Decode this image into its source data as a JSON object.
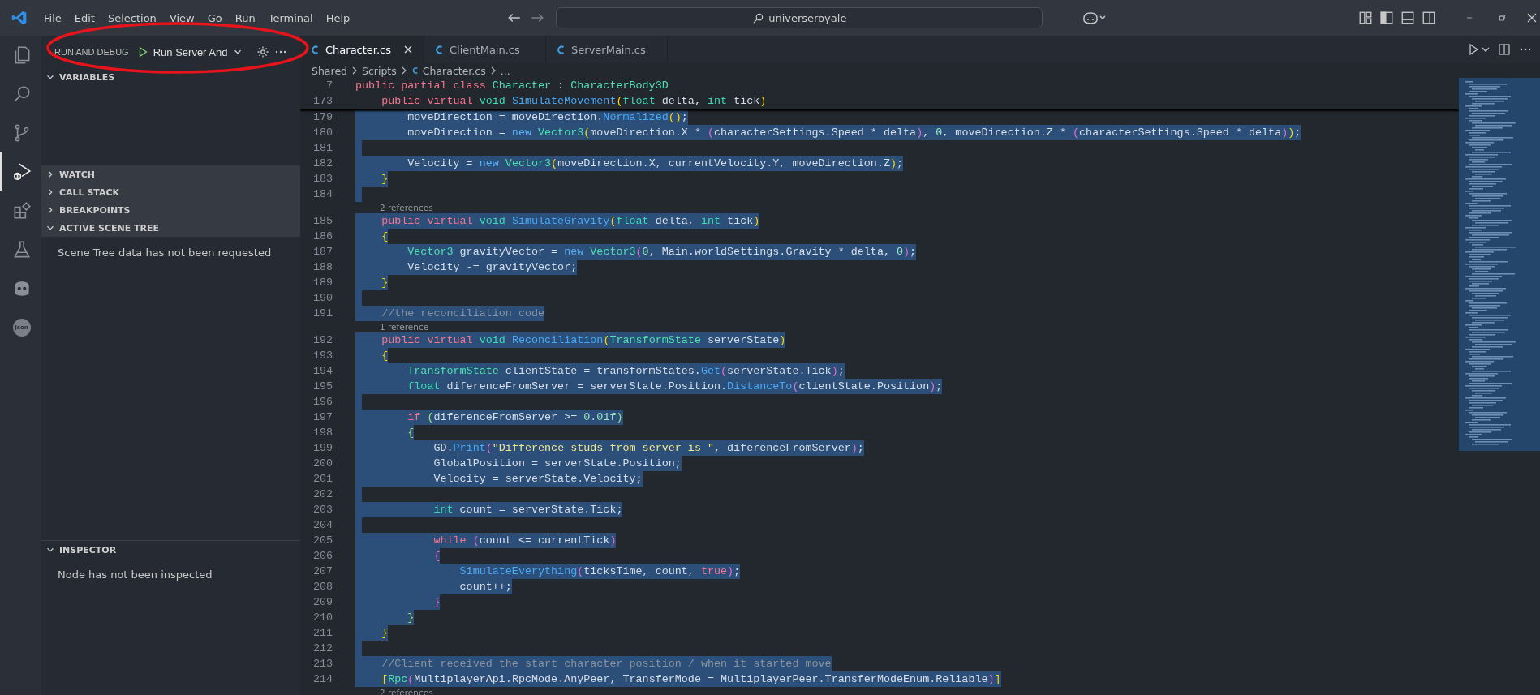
{
  "title_bar": {
    "menu": [
      "File",
      "Edit",
      "Selection",
      "View",
      "Go",
      "Run",
      "Terminal",
      "Help"
    ],
    "search": "universeroyale"
  },
  "activity_bar": [
    {
      "kind": "files",
      "selected": false
    },
    {
      "kind": "search",
      "selected": false
    },
    {
      "kind": "branch",
      "selected": false
    },
    {
      "kind": "debug",
      "selected": true
    },
    {
      "kind": "blocks",
      "selected": false
    },
    {
      "kind": "flask",
      "selected": false
    },
    {
      "kind": "robot",
      "selected": false
    },
    {
      "kind": "badge",
      "label": "Json",
      "selected": false
    }
  ],
  "sidebar": {
    "title": "RUN AND DEBUG",
    "configuration": "Run Server And",
    "sections": [
      {
        "title": "VARIABLES",
        "expanded": true
      },
      {
        "title": "WATCH",
        "expanded": false
      },
      {
        "title": "CALL STACK",
        "expanded": false
      },
      {
        "title": "BREAKPOINTS",
        "expanded": false
      },
      {
        "title": "ACTIVE SCENE TREE",
        "expanded": true,
        "message": "Scene Tree data has not been requested"
      },
      {
        "title": "INSPECTOR",
        "expanded": true,
        "message": "Node has not been inspected"
      }
    ]
  },
  "tabs": [
    {
      "label": "Character.cs",
      "selected": true
    },
    {
      "label": "ClientMain.cs",
      "selected": false
    },
    {
      "label": "ServerMain.cs",
      "selected": false
    }
  ],
  "breadcrumb": [
    "Shared",
    "Scripts",
    "Character.cs",
    "..."
  ],
  "sticky_scroll": [
    {
      "number": "7",
      "tokens": [
        {
          "text": "public partial class ",
          "kind": "kw"
        },
        {
          "text": "Character",
          "kind": "type"
        },
        {
          "text": " : ",
          "kind": "txt"
        },
        {
          "text": "CharacterBody3D",
          "kind": "type"
        }
      ]
    },
    {
      "number": "173",
      "tokens": [
        {
          "text": "    public virtual ",
          "kind": "kw"
        },
        {
          "text": "void ",
          "kind": "decl"
        },
        {
          "text": "SimulateMovement",
          "kind": "fn"
        },
        {
          "text": "(",
          "kind": "b1"
        },
        {
          "text": "float ",
          "kind": "decl"
        },
        {
          "text": "delta, ",
          "kind": "txt"
        },
        {
          "text": "int ",
          "kind": "decl"
        },
        {
          "text": "tick",
          "kind": "txt"
        },
        {
          "text": ")",
          "kind": "b1"
        }
      ]
    }
  ],
  "lines": [
    {
      "kind": "code",
      "number": "179",
      "selected": true,
      "tokens": [
        {
          "text": "        moveDirection = moveDirection.",
          "kind": "txt"
        },
        {
          "text": "Normalized",
          "kind": "fn"
        },
        {
          "text": "()",
          "kind": "b1"
        },
        {
          "text": ";",
          "kind": "txt"
        }
      ]
    },
    {
      "kind": "code",
      "number": "180",
      "selected": true,
      "tokens": [
        {
          "text": "        moveDirection = ",
          "kind": "txt"
        },
        {
          "text": "new ",
          "kind": "op"
        },
        {
          "text": "Vector3",
          "kind": "type"
        },
        {
          "text": "(",
          "kind": "b1"
        },
        {
          "text": "moveDirection.X * ",
          "kind": "txt"
        },
        {
          "text": "(",
          "kind": "b2"
        },
        {
          "text": "characterSettings.Speed * delta",
          "kind": "txt"
        },
        {
          "text": ")",
          "kind": "b2"
        },
        {
          "text": ", ",
          "kind": "txt"
        },
        {
          "text": "0",
          "kind": "num"
        },
        {
          "text": ", moveDirection.Z * ",
          "kind": "txt"
        },
        {
          "text": "(",
          "kind": "b2"
        },
        {
          "text": "characterSettings.Speed * delta",
          "kind": "txt"
        },
        {
          "text": ")",
          "kind": "b2"
        },
        {
          "text": ")",
          "kind": "b1"
        },
        {
          "text": ";",
          "kind": "txt"
        }
      ]
    },
    {
      "kind": "code",
      "number": "181",
      "selected": true
    },
    {
      "kind": "code",
      "number": "182",
      "selected": true,
      "tokens": [
        {
          "text": "        Velocity = ",
          "kind": "txt"
        },
        {
          "text": "new ",
          "kind": "op"
        },
        {
          "text": "Vector3",
          "kind": "type"
        },
        {
          "text": "(",
          "kind": "b1"
        },
        {
          "text": "moveDirection.X, currentVelocity.Y, moveDirection.Z",
          "kind": "txt"
        },
        {
          "text": ")",
          "kind": "b1"
        },
        {
          "text": ";",
          "kind": "txt"
        }
      ]
    },
    {
      "kind": "code",
      "number": "183",
      "selected": true,
      "tokens": [
        {
          "text": "    }",
          "kind": "b1"
        }
      ]
    },
    {
      "kind": "code",
      "number": "184",
      "selected": true
    },
    {
      "kind": "codelens",
      "text": "2 references"
    },
    {
      "kind": "code",
      "number": "185",
      "selected": true,
      "tokens": [
        {
          "text": "    public virtual ",
          "kind": "kw"
        },
        {
          "text": "void ",
          "kind": "decl"
        },
        {
          "text": "SimulateGravity",
          "kind": "fn"
        },
        {
          "text": "(",
          "kind": "b1"
        },
        {
          "text": "float ",
          "kind": "decl"
        },
        {
          "text": "delta, ",
          "kind": "txt"
        },
        {
          "text": "int ",
          "kind": "decl"
        },
        {
          "text": "tick",
          "kind": "txt"
        },
        {
          "text": ")",
          "kind": "b1"
        }
      ]
    },
    {
      "kind": "code",
      "number": "186",
      "selected": true,
      "tokens": [
        {
          "text": "    {",
          "kind": "b1"
        }
      ]
    },
    {
      "kind": "code",
      "number": "187",
      "selected": true,
      "tokens": [
        {
          "text": "        Vector3",
          "kind": "type"
        },
        {
          "text": " gravityVector = ",
          "kind": "txt"
        },
        {
          "text": "new ",
          "kind": "op"
        },
        {
          "text": "Vector3",
          "kind": "type"
        },
        {
          "text": "(",
          "kind": "b2"
        },
        {
          "text": "0",
          "kind": "num"
        },
        {
          "text": ", Main.worldSettings.Gravity * delta, ",
          "kind": "txt"
        },
        {
          "text": "0",
          "kind": "num"
        },
        {
          "text": ")",
          "kind": "b2"
        },
        {
          "text": ";",
          "kind": "txt"
        }
      ]
    },
    {
      "kind": "code",
      "number": "188",
      "selected": true,
      "tokens": [
        {
          "text": "        Velocity -= gravityVector;",
          "kind": "txt"
        }
      ]
    },
    {
      "kind": "code",
      "number": "189",
      "selected": true,
      "tokens": [
        {
          "text": "    }",
          "kind": "b1"
        }
      ]
    },
    {
      "kind": "code",
      "number": "190",
      "selected": true
    },
    {
      "kind": "code",
      "number": "191",
      "selected": true,
      "tokens": [
        {
          "text": "    //the reconciliation code",
          "kind": "cmt"
        }
      ]
    },
    {
      "kind": "codelens",
      "text": "1 reference"
    },
    {
      "kind": "code",
      "number": "192",
      "selected": true,
      "tokens": [
        {
          "text": "    public virtual ",
          "kind": "kw"
        },
        {
          "text": "void ",
          "kind": "decl"
        },
        {
          "text": "Reconciliation",
          "kind": "fn"
        },
        {
          "text": "(",
          "kind": "b1"
        },
        {
          "text": "TransformState",
          "kind": "type"
        },
        {
          "text": " serverState",
          "kind": "txt"
        },
        {
          "text": ")",
          "kind": "b1"
        }
      ]
    },
    {
      "kind": "code",
      "number": "193",
      "selected": true,
      "tokens": [
        {
          "text": "    {",
          "kind": "b1"
        }
      ]
    },
    {
      "kind": "code",
      "number": "194",
      "selected": true,
      "tokens": [
        {
          "text": "        TransformState",
          "kind": "type"
        },
        {
          "text": " clientState = transformStates.",
          "kind": "txt"
        },
        {
          "text": "Get",
          "kind": "fn"
        },
        {
          "text": "(",
          "kind": "b2"
        },
        {
          "text": "serverState.Tick",
          "kind": "txt"
        },
        {
          "text": ")",
          "kind": "b2"
        },
        {
          "text": ";",
          "kind": "txt"
        }
      ]
    },
    {
      "kind": "code",
      "number": "195",
      "selected": true,
      "tokens": [
        {
          "text": "        float ",
          "kind": "decl"
        },
        {
          "text": "diferenceFromServer = serverState.Position.",
          "kind": "txt"
        },
        {
          "text": "DistanceTo",
          "kind": "fn"
        },
        {
          "text": "(",
          "kind": "b2"
        },
        {
          "text": "clientState.Position",
          "kind": "txt"
        },
        {
          "text": ")",
          "kind": "b2"
        },
        {
          "text": ";",
          "kind": "txt"
        }
      ]
    },
    {
      "kind": "code",
      "number": "196",
      "selected": true
    },
    {
      "kind": "code",
      "number": "197",
      "selected": true,
      "tokens": [
        {
          "text": "        if ",
          "kind": "kw"
        },
        {
          "text": "(",
          "kind": "b4"
        },
        {
          "text": "diferenceFromServer >= ",
          "kind": "txt"
        },
        {
          "text": "0.01f",
          "kind": "num"
        },
        {
          "text": ")",
          "kind": "b4"
        }
      ]
    },
    {
      "kind": "code",
      "number": "198",
      "selected": true,
      "tokens": [
        {
          "text": "        {",
          "kind": "b4"
        }
      ]
    },
    {
      "kind": "code",
      "number": "199",
      "selected": true,
      "tokens": [
        {
          "text": "            GD.",
          "kind": "txt"
        },
        {
          "text": "Print",
          "kind": "fn"
        },
        {
          "text": "(",
          "kind": "b2"
        },
        {
          "text": "\"Difference studs from server is \"",
          "kind": "str"
        },
        {
          "text": ", diferenceFromServer",
          "kind": "txt"
        },
        {
          "text": ")",
          "kind": "b2"
        },
        {
          "text": ";",
          "kind": "txt"
        }
      ]
    },
    {
      "kind": "code",
      "number": "200",
      "selected": true,
      "tokens": [
        {
          "text": "            GlobalPosition = serverState.Position;",
          "kind": "txt"
        }
      ]
    },
    {
      "kind": "code",
      "number": "201",
      "selected": true,
      "tokens": [
        {
          "text": "            Velocity = serverState.Velocity;",
          "kind": "txt"
        }
      ]
    },
    {
      "kind": "code",
      "number": "202",
      "selected": true
    },
    {
      "kind": "code",
      "number": "203",
      "selected": true,
      "tokens": [
        {
          "text": "            int ",
          "kind": "decl"
        },
        {
          "text": "count = serverState.Tick;",
          "kind": "txt"
        }
      ]
    },
    {
      "kind": "code",
      "number": "204",
      "selected": true
    },
    {
      "kind": "code",
      "number": "205",
      "selected": true,
      "tokens": [
        {
          "text": "            while ",
          "kind": "kw"
        },
        {
          "text": "(",
          "kind": "b2"
        },
        {
          "text": "count <= currentTick",
          "kind": "txt"
        },
        {
          "text": ")",
          "kind": "b2"
        }
      ]
    },
    {
      "kind": "code",
      "number": "206",
      "selected": true,
      "tokens": [
        {
          "text": "            {",
          "kind": "b2"
        }
      ]
    },
    {
      "kind": "code",
      "number": "207",
      "selected": true,
      "tokens": [
        {
          "text": "                SimulateEverything",
          "kind": "fn"
        },
        {
          "text": "(",
          "kind": "b2"
        },
        {
          "text": "ticksTime, count, ",
          "kind": "txt"
        },
        {
          "text": "true",
          "kind": "kw"
        },
        {
          "text": ")",
          "kind": "b2"
        },
        {
          "text": ";",
          "kind": "txt"
        }
      ]
    },
    {
      "kind": "code",
      "number": "208",
      "selected": true,
      "tokens": [
        {
          "text": "                count++;",
          "kind": "txt"
        }
      ]
    },
    {
      "kind": "code",
      "number": "209",
      "selected": true,
      "tokens": [
        {
          "text": "            }",
          "kind": "b2"
        }
      ]
    },
    {
      "kind": "code",
      "number": "210",
      "selected": true,
      "tokens": [
        {
          "text": "        }",
          "kind": "b4"
        }
      ]
    },
    {
      "kind": "code",
      "number": "211",
      "selected": true,
      "tokens": [
        {
          "text": "    }",
          "kind": "b1"
        }
      ]
    },
    {
      "kind": "code",
      "number": "212",
      "selected": true
    },
    {
      "kind": "code",
      "number": "213",
      "selected": true,
      "tokens": [
        {
          "text": "    //Client received the start character position / when it started move",
          "kind": "cmt"
        }
      ]
    },
    {
      "kind": "code",
      "number": "214",
      "selected": true,
      "tokens": [
        {
          "text": "    [",
          "kind": "b1"
        },
        {
          "text": "Rpc",
          "kind": "type"
        },
        {
          "text": "(",
          "kind": "b2"
        },
        {
          "text": "MultiplayerApi.RpcMode.AnyPeer, TransferMode = MultiplayerPeer.TransferModeEnum.Reliable",
          "kind": "txt"
        },
        {
          "text": ")",
          "kind": "b2"
        },
        {
          "text": "]",
          "kind": "b1"
        }
      ]
    },
    {
      "kind": "codelens",
      "text": "2 references"
    }
  ]
}
